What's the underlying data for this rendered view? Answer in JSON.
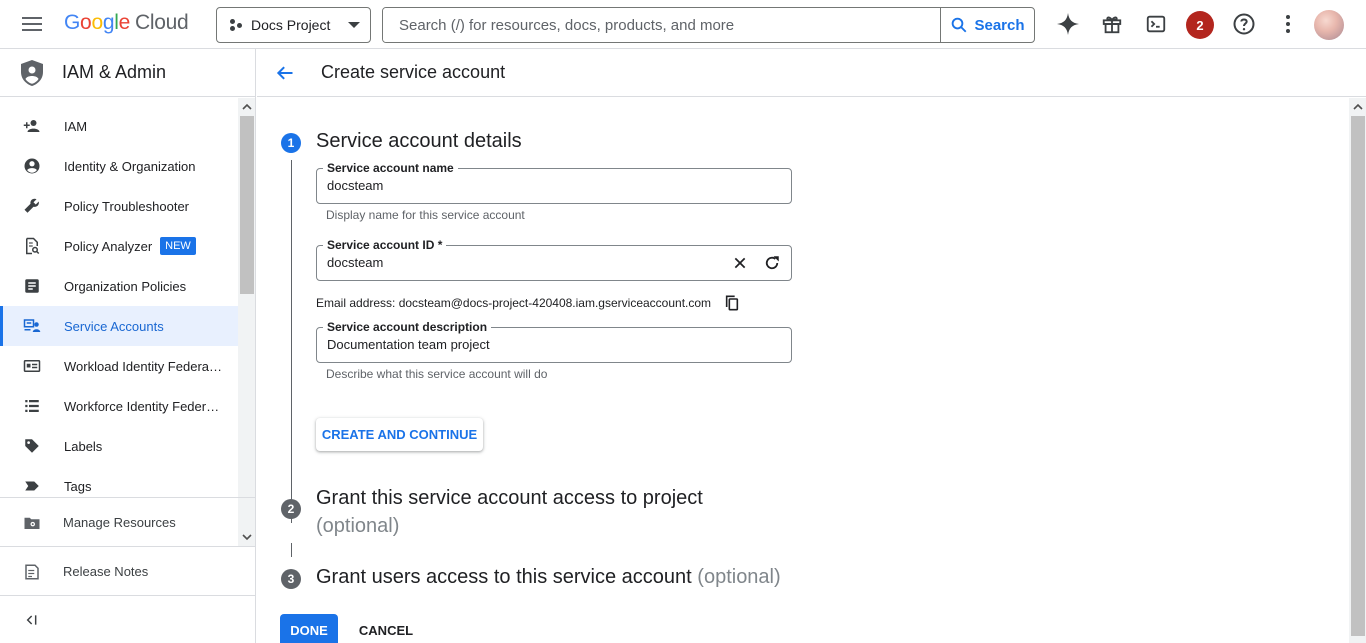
{
  "topbar": {
    "logo_parts": [
      "G",
      "o",
      "o",
      "g",
      "l",
      "e"
    ],
    "logo_suffix": "Cloud",
    "project_name": "Docs Project",
    "search_placeholder": "Search (/) for resources, docs, products, and more",
    "search_button": "Search",
    "notification_count": "2",
    "icons": [
      "menu-icon",
      "gemini-sparkle-icon",
      "gift-icon",
      "cloud-shell-icon",
      "help-icon",
      "more-vert-icon"
    ]
  },
  "sidebar": {
    "title": "IAM & Admin",
    "items": [
      {
        "label": "IAM",
        "icon": "person-add-icon"
      },
      {
        "label": "Identity & Organization",
        "icon": "account-circle-icon"
      },
      {
        "label": "Policy Troubleshooter",
        "icon": "wrench-icon"
      },
      {
        "label": "Policy Analyzer",
        "icon": "document-search-icon",
        "badge": "NEW"
      },
      {
        "label": "Organization Policies",
        "icon": "list-doc-icon"
      },
      {
        "label": "Service Accounts",
        "icon": "service-account-icon",
        "active": true
      },
      {
        "label": "Workload Identity Federat...",
        "icon": "id-card-icon"
      },
      {
        "label": "Workforce Identity Federa...",
        "icon": "list-icon"
      },
      {
        "label": "Labels",
        "icon": "label-icon"
      },
      {
        "label": "Tags",
        "icon": "tag-icon"
      }
    ],
    "footer": [
      {
        "label": "Manage Resources",
        "icon": "folder-gear-icon"
      },
      {
        "label": "Release Notes",
        "icon": "notes-icon"
      }
    ],
    "collapse_icon": "collapse-left-icon"
  },
  "main": {
    "title": "Create service account",
    "steps": [
      {
        "number": "1",
        "title": "Service account details"
      },
      {
        "number": "2",
        "title": "Grant this service account access to project",
        "optional": "(optional)"
      },
      {
        "number": "3",
        "title": "Grant users access to this service account",
        "optional": "(optional)"
      }
    ],
    "form": {
      "name_label": "Service account name",
      "name_value": "docsteam",
      "name_hint": "Display name for this service account",
      "id_label": "Service account ID *",
      "id_value": "docsteam",
      "email_text": "Email address: docsteam@docs-project-420408.iam.gserviceaccount.com",
      "desc_label": "Service account description",
      "desc_value": "Documentation team project",
      "desc_hint": "Describe what this service account will do"
    },
    "create_button": "CREATE AND CONTINUE",
    "done_button": "DONE",
    "cancel_button": "CANCEL"
  },
  "colors": {
    "accent": "#1a73e8",
    "active_bg": "#e8f0fe",
    "notification": "#b3261e"
  }
}
